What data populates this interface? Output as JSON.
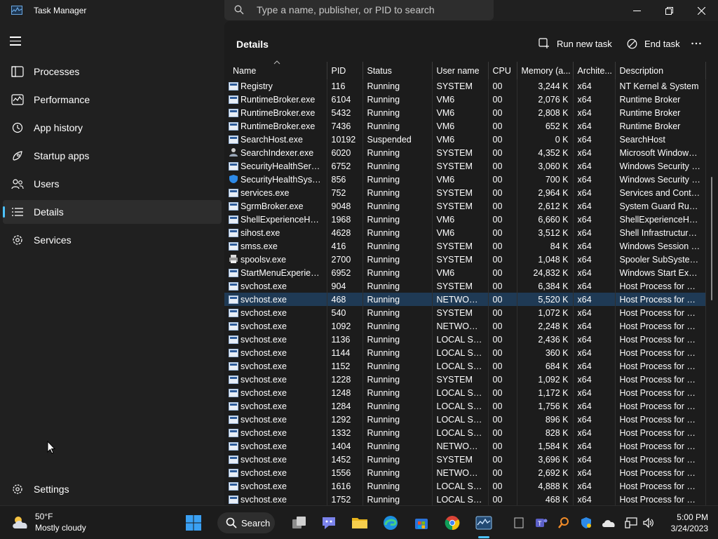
{
  "window": {
    "title": "Task Manager"
  },
  "search": {
    "placeholder": "Type a name, publisher, or PID to search"
  },
  "sidebar": {
    "items": [
      {
        "label": "Processes",
        "icon": "processes-icon",
        "active": false
      },
      {
        "label": "Performance",
        "icon": "performance-icon",
        "active": false
      },
      {
        "label": "App history",
        "icon": "app-history-icon",
        "active": false
      },
      {
        "label": "Startup apps",
        "icon": "startup-apps-icon",
        "active": false
      },
      {
        "label": "Users",
        "icon": "users-icon",
        "active": false
      },
      {
        "label": "Details",
        "icon": "details-icon",
        "active": true
      },
      {
        "label": "Services",
        "icon": "services-icon",
        "active": false
      }
    ],
    "settings_label": "Settings"
  },
  "main": {
    "title": "Details",
    "run_new_task": "Run new task",
    "end_task": "End task"
  },
  "table": {
    "columns": [
      "Name",
      "PID",
      "Status",
      "User name",
      "CPU",
      "Memory (a...",
      "Archite...",
      "Description"
    ],
    "rows": [
      [
        "Registry",
        "116",
        "Running",
        "SYSTEM",
        "00",
        "3,244 K",
        "x64",
        "NT Kernel & System"
      ],
      [
        "RuntimeBroker.exe",
        "6104",
        "Running",
        "VM6",
        "00",
        "2,076 K",
        "x64",
        "Runtime Broker"
      ],
      [
        "RuntimeBroker.exe",
        "5432",
        "Running",
        "VM6",
        "00",
        "2,808 K",
        "x64",
        "Runtime Broker"
      ],
      [
        "RuntimeBroker.exe",
        "7436",
        "Running",
        "VM6",
        "00",
        "652 K",
        "x64",
        "Runtime Broker"
      ],
      [
        "SearchHost.exe",
        "10192",
        "Suspended",
        "VM6",
        "00",
        "0 K",
        "x64",
        "SearchHost"
      ],
      [
        "SearchIndexer.exe",
        "6020",
        "Running",
        "SYSTEM",
        "00",
        "4,352 K",
        "x64",
        "Microsoft Windows ..."
      ],
      [
        "SecurityHealthServic...",
        "6752",
        "Running",
        "SYSTEM",
        "00",
        "3,060 K",
        "x64",
        "Windows Security H..."
      ],
      [
        "SecurityHealthSystra...",
        "856",
        "Running",
        "VM6",
        "00",
        "700 K",
        "x64",
        "Windows Security n..."
      ],
      [
        "services.exe",
        "752",
        "Running",
        "SYSTEM",
        "00",
        "2,964 K",
        "x64",
        "Services and Contro..."
      ],
      [
        "SgrmBroker.exe",
        "9048",
        "Running",
        "SYSTEM",
        "00",
        "2,612 K",
        "x64",
        "System Guard Runti..."
      ],
      [
        "ShellExperienceHost....",
        "1968",
        "Running",
        "VM6",
        "00",
        "6,660 K",
        "x64",
        "ShellExperienceHost"
      ],
      [
        "sihost.exe",
        "4628",
        "Running",
        "VM6",
        "00",
        "3,512 K",
        "x64",
        "Shell Infrastructure ..."
      ],
      [
        "smss.exe",
        "416",
        "Running",
        "SYSTEM",
        "00",
        "84 K",
        "x64",
        "Windows Session M..."
      ],
      [
        "spoolsv.exe",
        "2700",
        "Running",
        "SYSTEM",
        "00",
        "1,048 K",
        "x64",
        "Spooler SubSystem ..."
      ],
      [
        "StartMenuExperienc...",
        "6952",
        "Running",
        "VM6",
        "00",
        "24,832 K",
        "x64",
        "Windows Start Expe..."
      ],
      [
        "svchost.exe",
        "904",
        "Running",
        "SYSTEM",
        "00",
        "6,384 K",
        "x64",
        "Host Process for Wi..."
      ],
      [
        "svchost.exe",
        "468",
        "Running",
        "NETWORK...",
        "00",
        "5,520 K",
        "x64",
        "Host Process for Wi..."
      ],
      [
        "svchost.exe",
        "540",
        "Running",
        "SYSTEM",
        "00",
        "1,072 K",
        "x64",
        "Host Process for Wi..."
      ],
      [
        "svchost.exe",
        "1092",
        "Running",
        "NETWORK...",
        "00",
        "2,248 K",
        "x64",
        "Host Process for Wi..."
      ],
      [
        "svchost.exe",
        "1136",
        "Running",
        "LOCAL SE...",
        "00",
        "2,436 K",
        "x64",
        "Host Process for Wi..."
      ],
      [
        "svchost.exe",
        "1144",
        "Running",
        "LOCAL SE...",
        "00",
        "360 K",
        "x64",
        "Host Process for Wi..."
      ],
      [
        "svchost.exe",
        "1152",
        "Running",
        "LOCAL SE...",
        "00",
        "684 K",
        "x64",
        "Host Process for Wi..."
      ],
      [
        "svchost.exe",
        "1228",
        "Running",
        "SYSTEM",
        "00",
        "1,092 K",
        "x64",
        "Host Process for Wi..."
      ],
      [
        "svchost.exe",
        "1248",
        "Running",
        "LOCAL SE...",
        "00",
        "1,172 K",
        "x64",
        "Host Process for Wi..."
      ],
      [
        "svchost.exe",
        "1284",
        "Running",
        "LOCAL SE...",
        "00",
        "1,756 K",
        "x64",
        "Host Process for Wi..."
      ],
      [
        "svchost.exe",
        "1292",
        "Running",
        "LOCAL SE...",
        "00",
        "896 K",
        "x64",
        "Host Process for Wi..."
      ],
      [
        "svchost.exe",
        "1332",
        "Running",
        "LOCAL SE...",
        "00",
        "828 K",
        "x64",
        "Host Process for Wi..."
      ],
      [
        "svchost.exe",
        "1404",
        "Running",
        "NETWORK...",
        "00",
        "1,584 K",
        "x64",
        "Host Process for Wi..."
      ],
      [
        "svchost.exe",
        "1452",
        "Running",
        "SYSTEM",
        "00",
        "3,696 K",
        "x64",
        "Host Process for Wi..."
      ],
      [
        "svchost.exe",
        "1556",
        "Running",
        "NETWORK...",
        "00",
        "2,692 K",
        "x64",
        "Host Process for Wi..."
      ],
      [
        "svchost.exe",
        "1616",
        "Running",
        "LOCAL SE...",
        "00",
        "4,888 K",
        "x64",
        "Host Process for Wi..."
      ],
      [
        "svchost.exe",
        "1752",
        "Running",
        "LOCAL SE...",
        "00",
        "468 K",
        "x64",
        "Host Process for Wi..."
      ]
    ],
    "selected_row_index": 16,
    "row_icons": {
      "5": "user",
      "7": "shield",
      "13": "printer"
    }
  },
  "taskbar": {
    "weather_temp": "50°F",
    "weather_desc": "Mostly cloudy",
    "search_label": "Search",
    "time": "5:00 PM",
    "date": "3/24/2023"
  },
  "colors": {
    "accent": "#4cc2ff",
    "selected_row": "#1f3a55",
    "background": "#202020"
  }
}
